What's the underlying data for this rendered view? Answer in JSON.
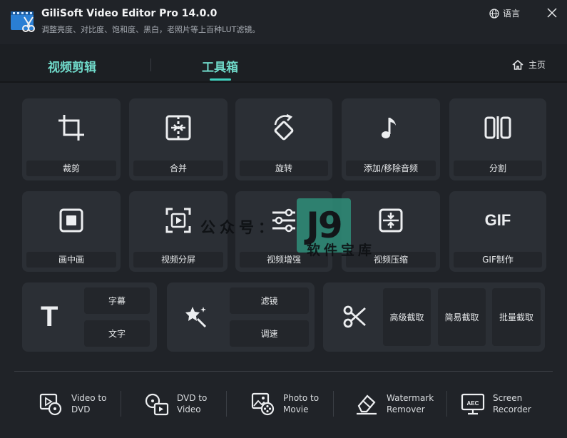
{
  "app": {
    "title": "GiliSoft Video Editor Pro 14.0.0",
    "subtitle": "调整亮度、对比度、饱和度、黑白，老照片等上百种LUT滤镜。",
    "language_label": "语言"
  },
  "tabs": {
    "video_edit": "视频剪辑",
    "toolbox": "工具箱",
    "home_label": "主页"
  },
  "tools_row1": [
    "裁剪",
    "合并",
    "旋转",
    "添加/移除音频",
    "分割"
  ],
  "tools_row2": [
    "画中画",
    "视频分屏",
    "视频增强",
    "视频压缩",
    "GIF制作"
  ],
  "gif_icon_text": "GIF",
  "text_group": {
    "icon_text": "T",
    "subtitle_btn": "字幕",
    "text_btn": "文字"
  },
  "effects_group": {
    "filter_btn": "滤镜",
    "speed_btn": "调速"
  },
  "cut_group": {
    "advanced": "高级截取",
    "simple": "简易截取",
    "batch": "批量截取"
  },
  "bottom_tools": [
    {
      "line1": "Video to",
      "line2": "DVD"
    },
    {
      "line1": "DVD to",
      "line2": "Video"
    },
    {
      "line1": "Photo to",
      "line2": "Movie"
    },
    {
      "line1": "Watermark",
      "line2": "Remover"
    },
    {
      "line1": "Screen",
      "line2": "Recorder"
    }
  ],
  "aec_icon_text": "AEC",
  "watermark": {
    "badge": "J9",
    "line1": "公众号：",
    "line2": "软件宝库"
  },
  "colors": {
    "accent": "#3fd0bd",
    "tab_text": "#6fd8c8",
    "card_bg": "#2b2f35",
    "bg": "#202328"
  }
}
